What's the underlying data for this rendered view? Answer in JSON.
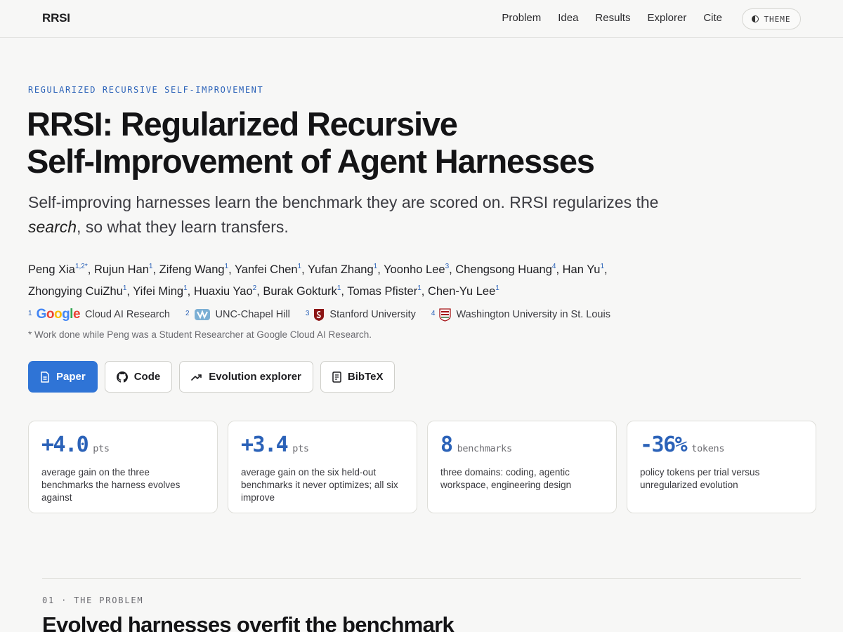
{
  "nav": {
    "brand": "RRSI",
    "links": [
      "Problem",
      "Idea",
      "Results",
      "Explorer",
      "Cite"
    ],
    "theme_label": "THEME"
  },
  "hero": {
    "eyebrow": "REGULARIZED RECURSIVE SELF-IMPROVEMENT",
    "title_line1": "RRSI: Regularized Recursive",
    "title_line2": "Self-Improvement of Agent Harnesses",
    "subtitle_pre": "Self-improving harnesses learn the benchmark they are scored on. RRSI regularizes the ",
    "subtitle_em": "search",
    "subtitle_post": ", so what they learn transfers."
  },
  "authors": [
    {
      "name": "Peng Xia",
      "sup": "1,2*"
    },
    {
      "name": "Rujun Han",
      "sup": "1"
    },
    {
      "name": "Zifeng Wang",
      "sup": "1"
    },
    {
      "name": "Yanfei Chen",
      "sup": "1"
    },
    {
      "name": "Yufan Zhang",
      "sup": "1"
    },
    {
      "name": "Yoonho Lee",
      "sup": "3"
    },
    {
      "name": "Chengsong Huang",
      "sup": "4"
    },
    {
      "name": "Han Yu",
      "sup": "1"
    },
    {
      "name": "Zhongying CuiZhu",
      "sup": "1"
    },
    {
      "name": "Yifei Ming",
      "sup": "1"
    },
    {
      "name": "Huaxiu Yao",
      "sup": "2"
    },
    {
      "name": "Burak Gokturk",
      "sup": "1"
    },
    {
      "name": "Tomas Pfister",
      "sup": "1"
    },
    {
      "name": "Chen-Yu Lee",
      "sup": "1"
    }
  ],
  "affiliations": [
    {
      "num": "1",
      "logo_text": "Google",
      "name": "Cloud AI Research",
      "logo": "google-logo"
    },
    {
      "num": "2",
      "name": "UNC-Chapel Hill",
      "logo": "unc-logo"
    },
    {
      "num": "3",
      "name": "Stanford University",
      "logo": "stanford-logo"
    },
    {
      "num": "4",
      "name": "Washington University in St. Louis",
      "logo": "washu-logo"
    }
  ],
  "note": "* Work done while Peng was a Student Researcher at Google Cloud AI Research.",
  "buttons": {
    "paper": "Paper",
    "code": "Code",
    "explorer": "Evolution explorer",
    "bibtex": "BibTeX"
  },
  "stats": [
    {
      "value": "+4.0",
      "unit": "pts",
      "desc": "average gain on the three benchmarks the harness evolves against"
    },
    {
      "value": "+3.4",
      "unit": "pts",
      "desc": "average gain on the six held-out benchmarks it never optimizes; all six improve"
    },
    {
      "value": "8",
      "unit": "benchmarks",
      "desc": "three domains: coding, agentic workspace, engineering design"
    },
    {
      "value": "-36%",
      "unit": "tokens",
      "desc": "policy tokens per trial versus unregularized evolution"
    }
  ],
  "section": {
    "label": "01 · THE PROBLEM",
    "title": "Evolved harnesses overfit the benchmark"
  },
  "colors": {
    "accent": "#2b62b8",
    "primary_button": "#2f74d6",
    "background": "#f7f7f6"
  }
}
